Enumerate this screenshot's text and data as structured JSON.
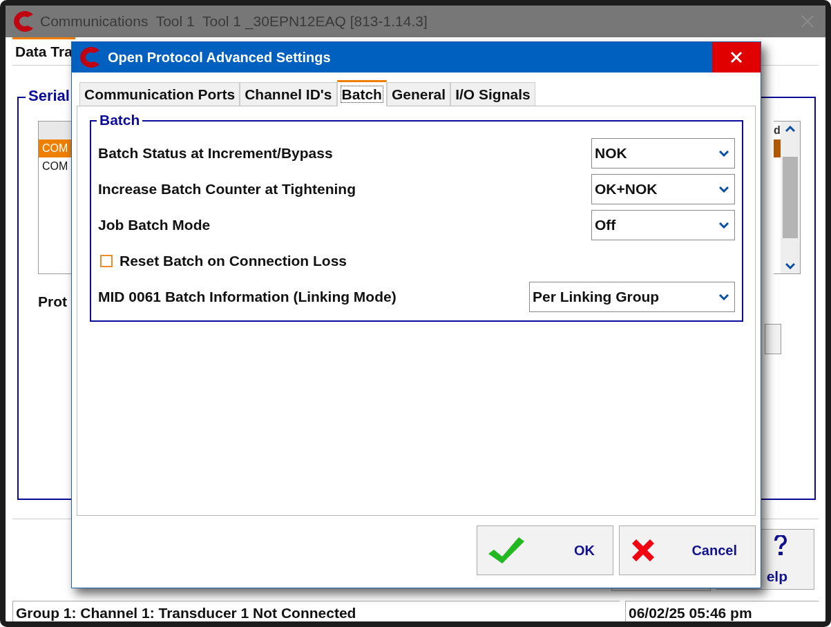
{
  "main_window": {
    "title": "Communications  Tool 1  Tool 1 _30EPN12EAQ [813-1.14.3]",
    "tab": {
      "label": "Data Tra",
      "selected": true
    },
    "group_title": "Serial",
    "port_list": {
      "header_right": "d",
      "rows": [
        {
          "label": "COM",
          "selected": true
        },
        {
          "label": "COM",
          "selected": false
        }
      ]
    },
    "protocol_label": "Prot",
    "help_button": {
      "label": "elp"
    },
    "status_bar": {
      "message": "Group 1: Channel 1: Transducer 1 Not Connected",
      "datetime": "06/02/25 05:46 pm"
    }
  },
  "dialog": {
    "title": "Open Protocol Advanced Settings",
    "tabs": [
      {
        "label": "Communication Ports",
        "selected": false
      },
      {
        "label": "Channel ID's",
        "selected": false
      },
      {
        "label": "Batch",
        "selected": true
      },
      {
        "label": "General",
        "selected": false
      },
      {
        "label": "I/O Signals",
        "selected": false
      }
    ],
    "group_title": "Batch",
    "settings": [
      {
        "kind": "dropdown",
        "label": "Batch Status at Increment/Bypass",
        "value": "NOK"
      },
      {
        "kind": "dropdown",
        "label": "Increase Batch Counter at Tightening",
        "value": "OK+NOK"
      },
      {
        "kind": "dropdown",
        "label": "Job Batch Mode",
        "value": "Off"
      },
      {
        "kind": "checkbox",
        "label": "Reset Batch on Connection Loss",
        "checked": false
      },
      {
        "kind": "wide-dropdown",
        "label": "MID 0061 Batch Information (Linking Mode)",
        "value": "Per Linking Group"
      }
    ],
    "buttons": [
      {
        "kind": "ok",
        "label": "OK"
      },
      {
        "kind": "cancel",
        "label": "Cancel"
      }
    ]
  }
}
